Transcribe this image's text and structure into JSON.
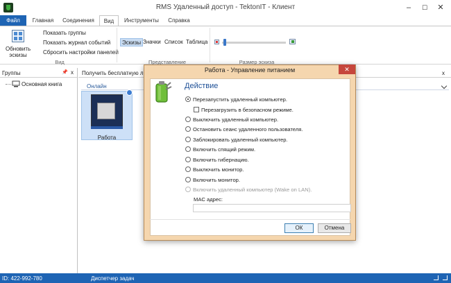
{
  "window": {
    "title": "RMS Удаленный доступ - TektonIT - Клиент",
    "min": "–",
    "max": "☐",
    "close": "✕"
  },
  "tabs": [
    {
      "label": "Файл"
    },
    {
      "label": "Главная"
    },
    {
      "label": "Соединения"
    },
    {
      "label": "Вид"
    },
    {
      "label": "Инструменты"
    },
    {
      "label": "Справка"
    }
  ],
  "ribbon": {
    "refresh_line1": "Обновить",
    "refresh_line2": "эскизы",
    "show_groups": "Показать группы",
    "show_event_log": "Показать журнал событий",
    "reset_panels": "Сбросить настройки панелей",
    "group_view": "Вид",
    "view_modes": [
      "Эскизы",
      "Значки",
      "Список",
      "Таблица"
    ],
    "group_representation": "Представление",
    "group_thumb_size": "Размер эскиза"
  },
  "groups_panel": {
    "title": "Группы",
    "pin": "📌",
    "close": "x",
    "root": "Основная книга"
  },
  "main_panel": {
    "banner": "Получить бесплатную лицензию",
    "close": "x",
    "section": "Онлайн",
    "thumb_label": "Работа"
  },
  "statusbar": {
    "id": "ID: 422-992-780",
    "task_manager": "Диспетчер задач"
  },
  "dialog": {
    "title": "Работа - Управление питанием",
    "close": "✕",
    "heading": "Действие",
    "options": [
      {
        "label": "Перезапустить удаленный компьютер.",
        "checked": true
      },
      {
        "label": "Выключить удаленный компьютер.",
        "checked": false
      },
      {
        "label": "Остановить сеанс удаленного пользователя.",
        "checked": false
      },
      {
        "label": "Заблокировать удаленный компьютер.",
        "checked": false
      },
      {
        "label": "Включить спящий режим.",
        "checked": false
      },
      {
        "label": "Включить гибернацию.",
        "checked": false
      },
      {
        "label": "Выключить монитор.",
        "checked": false
      },
      {
        "label": "Включить монитор.",
        "checked": false
      },
      {
        "label": "Включить удаленный компьютер (Wake on LAN).",
        "checked": false,
        "disabled": true
      }
    ],
    "safe_mode": "Перезагрузить в безопасном режиме.",
    "mac_label": "MAC адрес:",
    "mac_value": "",
    "ok": "ОК",
    "cancel": "Отмена"
  }
}
